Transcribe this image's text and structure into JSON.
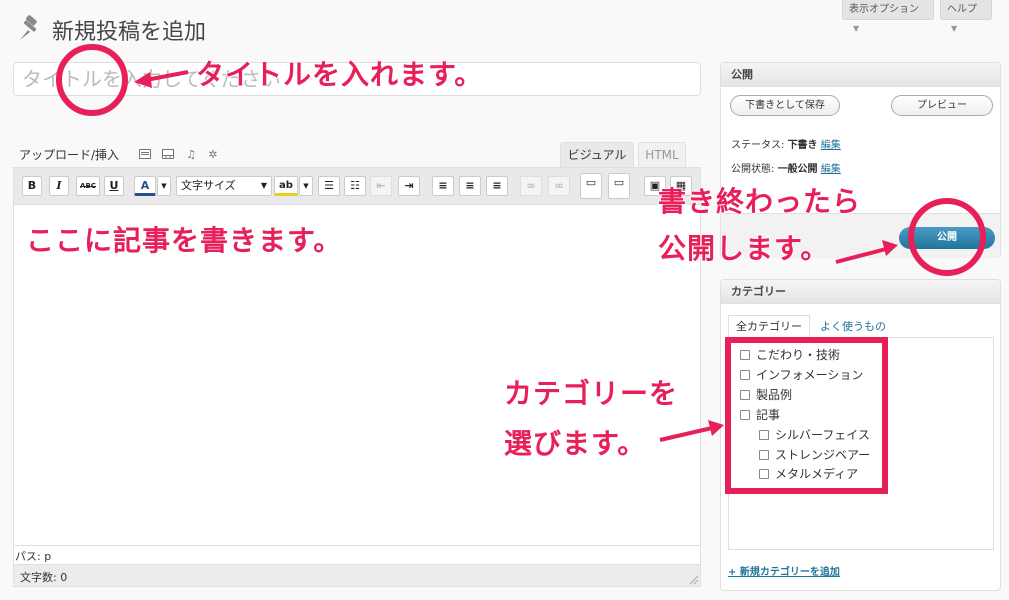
{
  "top_buttons": {
    "screen_options": "表示オプション",
    "help": "ヘルプ"
  },
  "page": {
    "title": "新規投稿を追加",
    "title_placeholder": "タイトルを入力してください"
  },
  "editor": {
    "upload_label": "アップロード/挿入",
    "tab_visual": "ビジュアル",
    "tab_html": "HTML",
    "format_select": "文字サイズ",
    "buttons": {
      "bold": "B",
      "italic": "I",
      "strike": "ABC",
      "underline": "U",
      "text_color": "A",
      "paste": "ab"
    },
    "path": "パス: p",
    "word_count": "文字数: 0"
  },
  "publish": {
    "heading": "公開",
    "save_draft": "下書きとして保存",
    "preview": "プレビュー",
    "status_label": "ステータス:",
    "status_value": "下書き",
    "visibility_label": "公開状態:",
    "visibility_value": "一般公開",
    "edit": "編集",
    "publish_button": "公開"
  },
  "categories": {
    "heading": "カテゴリー",
    "tab_all": "全カテゴリー",
    "tab_popular": "よく使うもの",
    "items": [
      "こだわり・技術",
      "インフォメーション",
      "製品例",
      "記事",
      "シルバーフェイス",
      "ストレンジベアー",
      "メタルメディア"
    ],
    "add_new": "+ 新規カテゴリーを追加"
  },
  "annotations": {
    "title": "タイトルを入れます。",
    "body": "ここに記事を書きます。",
    "publish_line1": "書き終わったら",
    "publish_line2": "公開します。",
    "category_line1": "カテゴリーを",
    "category_line2": "選びます。"
  },
  "colors": {
    "annotation": "#e8205a",
    "publish_button": "#21759b",
    "link": "#21759b"
  },
  "icons": [
    "pin-icon",
    "image-icon",
    "video-icon",
    "music-icon",
    "media-icon"
  ]
}
